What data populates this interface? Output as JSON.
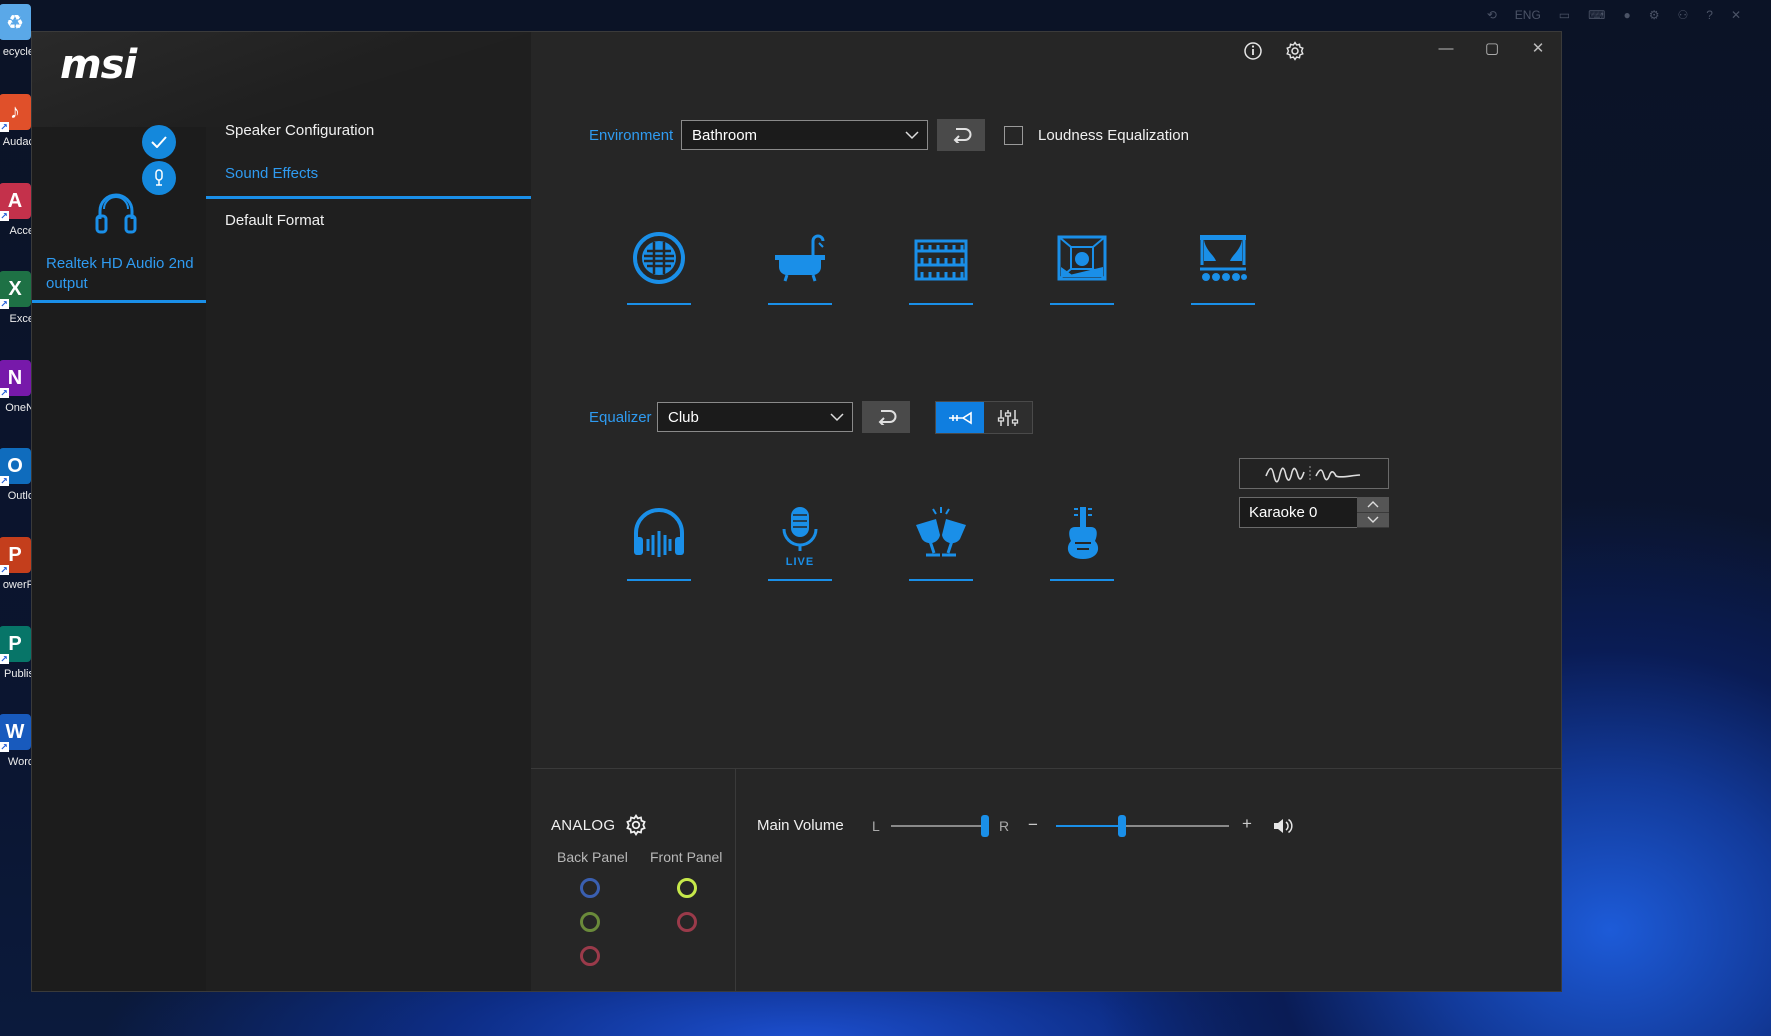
{
  "desktop": {
    "tray": [
      "ENG"
    ],
    "icons": [
      {
        "label": "ecycle",
        "icon": "recycle-bin-icon",
        "color": "#5aa8e8",
        "glyph": "♻"
      },
      {
        "label": "Audac",
        "icon": "audacity-icon",
        "color": "#e0502a",
        "glyph": "♪"
      },
      {
        "label": "Acce",
        "icon": "access-icon",
        "color": "#c4314b",
        "glyph": "A"
      },
      {
        "label": "Exce",
        "icon": "excel-icon",
        "color": "#1e7145",
        "glyph": "X"
      },
      {
        "label": "OneN",
        "icon": "onenote-icon",
        "color": "#7719aa",
        "glyph": "N"
      },
      {
        "label": "Outlo",
        "icon": "outlook-icon",
        "color": "#0f6cbd",
        "glyph": "O"
      },
      {
        "label": "owerP",
        "icon": "powerpoint-icon",
        "color": "#c43e1c",
        "glyph": "P"
      },
      {
        "label": "Publis",
        "icon": "publisher-icon",
        "color": "#077568",
        "glyph": "P"
      },
      {
        "label": "Word",
        "icon": "word-icon",
        "color": "#185abd",
        "glyph": "W"
      }
    ]
  },
  "app": {
    "logo": "msi",
    "device": {
      "name": "Realtek HD Audio 2nd output"
    },
    "nav": [
      {
        "label": "Speaker Configuration",
        "active": false
      },
      {
        "label": "Sound Effects",
        "active": true
      },
      {
        "label": "Default Format",
        "active": false
      }
    ],
    "environment": {
      "label": "Environment",
      "value": "Bathroom",
      "loudness_label": "Loudness Equalization",
      "loudness_checked": false,
      "presets": [
        "speaker-grille-icon",
        "bathtub-icon",
        "colosseum-icon",
        "room-icon",
        "stage-icon"
      ]
    },
    "equalizer": {
      "label": "Equalizer",
      "value": "Club",
      "presets": [
        "headphone-bars-icon",
        "live-microphone-icon",
        "cheers-icon",
        "guitar-icon"
      ],
      "karaoke": "Karaoke 0"
    },
    "bottom": {
      "analog_label": "ANALOG",
      "back_panel": "Back Panel",
      "front_panel": "Front Panel",
      "back_jacks": [
        "#3a5fb0",
        "#6a8a3a",
        "#9a3a4a"
      ],
      "front_jacks": [
        "#c6e84a",
        "#9a3a4a"
      ],
      "main_volume_label": "Main Volume",
      "balance_left": "L",
      "balance_right": "R",
      "balance": 1.0,
      "volume": 0.38,
      "minus": "−",
      "plus": "+"
    },
    "accent": "#1a8fe8"
  }
}
